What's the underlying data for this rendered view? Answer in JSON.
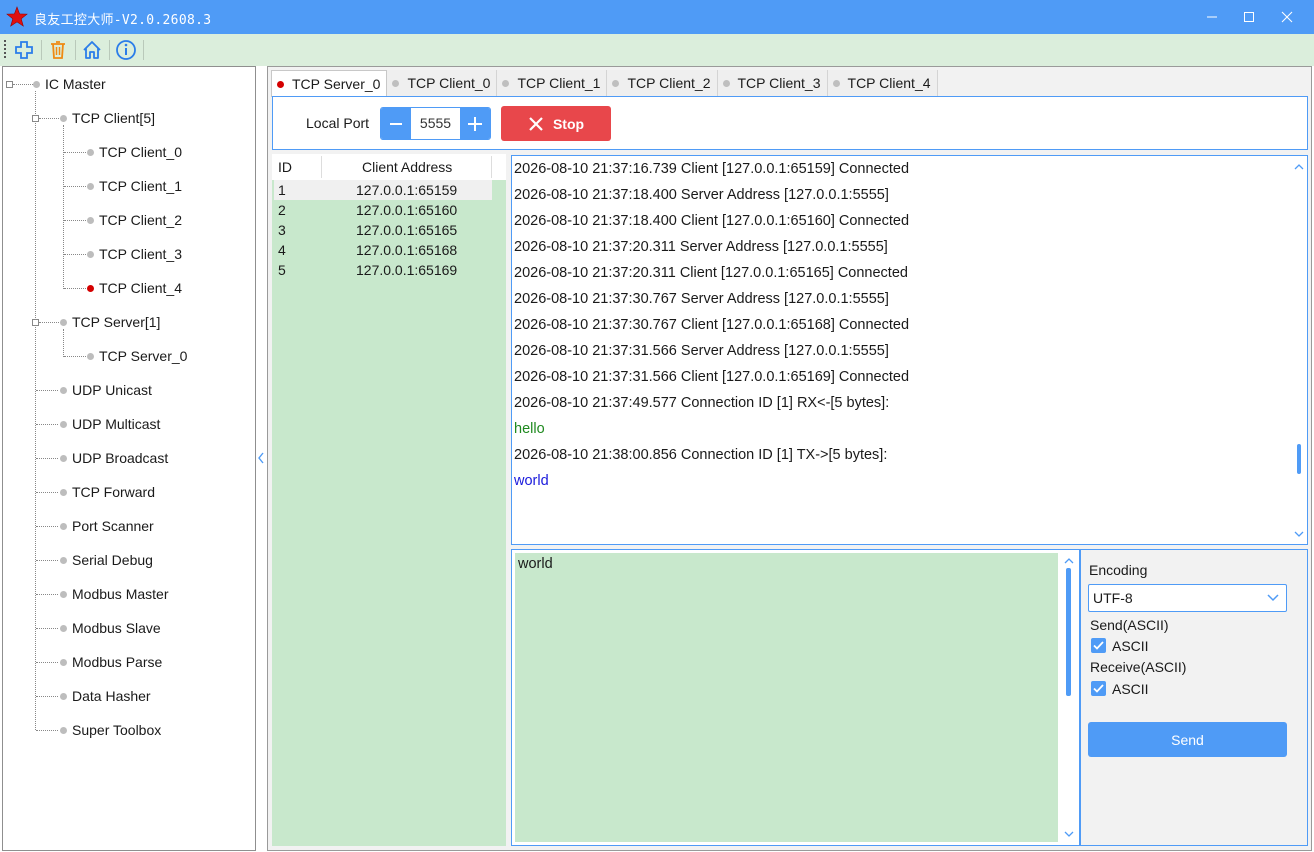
{
  "window": {
    "title": "良友工控大师-V2.0.2608.3",
    "minimize": "minimize",
    "maximize": "maximize",
    "close": "close"
  },
  "toolbar": {
    "icons": [
      "add-icon",
      "delete-icon",
      "home-icon",
      "info-icon"
    ]
  },
  "tree": {
    "root": "IC Master",
    "tcp_client_group": "TCP Client[5]",
    "tcp_clients": [
      "TCP Client_0",
      "TCP Client_1",
      "TCP Client_2",
      "TCP Client_3",
      "TCP Client_4"
    ],
    "tcp_server_group": "TCP Server[1]",
    "tcp_servers": [
      "TCP Server_0"
    ],
    "tools": [
      "UDP Unicast",
      "UDP Multicast",
      "UDP Broadcast",
      "TCP Forward",
      "Port Scanner",
      "Serial Debug",
      "Modbus Master",
      "Modbus Slave",
      "Modbus Parse",
      "Data Hasher",
      "Super Toolbox"
    ]
  },
  "tabs": [
    "TCP Server_0",
    "TCP Client_0",
    "TCP Client_1",
    "TCP Client_2",
    "TCP Client_3",
    "TCP Client_4"
  ],
  "active_tab": "TCP Server_0",
  "port": {
    "label": "Local Port",
    "value": "5555",
    "stop_label": "Stop"
  },
  "clients": {
    "header_id": "ID",
    "header_address": "Client Address",
    "rows": [
      {
        "id": "1",
        "address": "127.0.0.1:65159"
      },
      {
        "id": "2",
        "address": "127.0.0.1:65160"
      },
      {
        "id": "3",
        "address": "127.0.0.1:65165"
      },
      {
        "id": "4",
        "address": "127.0.0.1:65168"
      },
      {
        "id": "5",
        "address": "127.0.0.1:65169"
      }
    ]
  },
  "log": [
    {
      "text": "2026-08-10 21:37:16.739 Client [127.0.0.1:65159] Connected",
      "color": "#1a1a1a"
    },
    {
      "text": "2026-08-10 21:37:18.400 Server Address [127.0.0.1:5555]",
      "color": "#1a1a1a"
    },
    {
      "text": "2026-08-10 21:37:18.400 Client [127.0.0.1:65160] Connected",
      "color": "#1a1a1a"
    },
    {
      "text": "2026-08-10 21:37:20.311 Server Address [127.0.0.1:5555]",
      "color": "#1a1a1a"
    },
    {
      "text": "2026-08-10 21:37:20.311 Client [127.0.0.1:65165] Connected",
      "color": "#1a1a1a"
    },
    {
      "text": "2026-08-10 21:37:30.767 Server Address [127.0.0.1:5555]",
      "color": "#1a1a1a"
    },
    {
      "text": "2026-08-10 21:37:30.767 Client [127.0.0.1:65168] Connected",
      "color": "#1a1a1a"
    },
    {
      "text": "2026-08-10 21:37:31.566 Server Address [127.0.0.1:5555]",
      "color": "#1a1a1a"
    },
    {
      "text": "2026-08-10 21:37:31.566 Client [127.0.0.1:65169] Connected",
      "color": "#1a1a1a"
    },
    {
      "text": "2026-08-10 21:37:49.577 Connection ID [1] RX<-[5 bytes]:",
      "color": "#1a1a1a"
    },
    {
      "text": "hello",
      "color": "#1f8a1f"
    },
    {
      "text": "2026-08-10 21:38:00.856 Connection ID [1] TX->[5 bytes]:",
      "color": "#1a1a1a"
    },
    {
      "text": "world",
      "color": "#1a1adc"
    }
  ],
  "send": {
    "text": "world",
    "encoding_label": "Encoding",
    "encoding_value": "UTF-8",
    "send_mode_label": "Send(ASCII)",
    "send_ascii_label": "ASCII",
    "send_ascii_checked": true,
    "receive_mode_label": "Receive(ASCII)",
    "receive_ascii_label": "ASCII",
    "receive_ascii_checked": true,
    "send_button": "Send"
  },
  "colors": {
    "accent": "#4f9bf6",
    "stop": "#e8474b",
    "list_bg": "#c8e8cc",
    "toolbar_bg": "#dbeedc",
    "active_dot": "#d40000"
  }
}
